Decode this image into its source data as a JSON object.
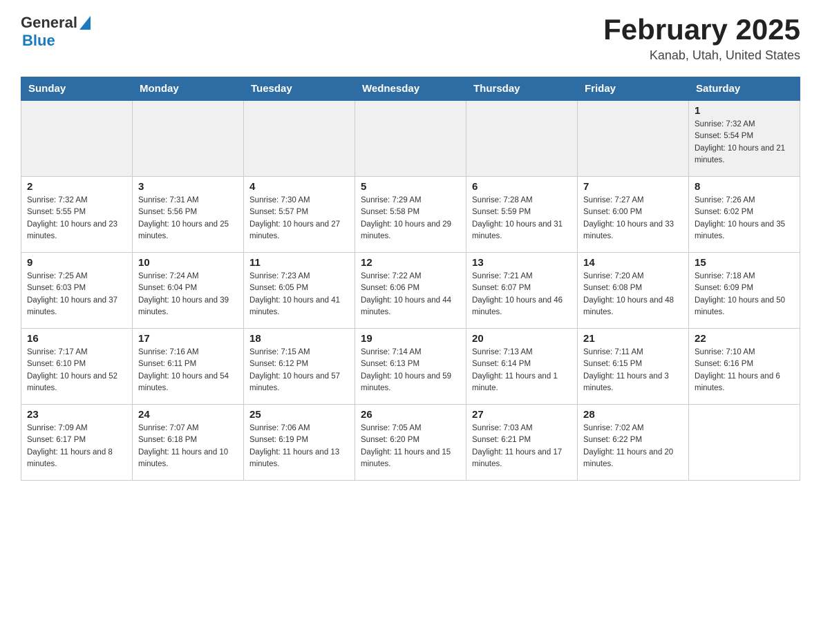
{
  "logo": {
    "general": "General",
    "blue": "Blue"
  },
  "title": "February 2025",
  "subtitle": "Kanab, Utah, United States",
  "headers": [
    "Sunday",
    "Monday",
    "Tuesday",
    "Wednesday",
    "Thursday",
    "Friday",
    "Saturday"
  ],
  "weeks": [
    [
      {
        "day": "",
        "sunrise": "",
        "sunset": "",
        "daylight": ""
      },
      {
        "day": "",
        "sunrise": "",
        "sunset": "",
        "daylight": ""
      },
      {
        "day": "",
        "sunrise": "",
        "sunset": "",
        "daylight": ""
      },
      {
        "day": "",
        "sunrise": "",
        "sunset": "",
        "daylight": ""
      },
      {
        "day": "",
        "sunrise": "",
        "sunset": "",
        "daylight": ""
      },
      {
        "day": "",
        "sunrise": "",
        "sunset": "",
        "daylight": ""
      },
      {
        "day": "1",
        "sunrise": "Sunrise: 7:32 AM",
        "sunset": "Sunset: 5:54 PM",
        "daylight": "Daylight: 10 hours and 21 minutes."
      }
    ],
    [
      {
        "day": "2",
        "sunrise": "Sunrise: 7:32 AM",
        "sunset": "Sunset: 5:55 PM",
        "daylight": "Daylight: 10 hours and 23 minutes."
      },
      {
        "day": "3",
        "sunrise": "Sunrise: 7:31 AM",
        "sunset": "Sunset: 5:56 PM",
        "daylight": "Daylight: 10 hours and 25 minutes."
      },
      {
        "day": "4",
        "sunrise": "Sunrise: 7:30 AM",
        "sunset": "Sunset: 5:57 PM",
        "daylight": "Daylight: 10 hours and 27 minutes."
      },
      {
        "day": "5",
        "sunrise": "Sunrise: 7:29 AM",
        "sunset": "Sunset: 5:58 PM",
        "daylight": "Daylight: 10 hours and 29 minutes."
      },
      {
        "day": "6",
        "sunrise": "Sunrise: 7:28 AM",
        "sunset": "Sunset: 5:59 PM",
        "daylight": "Daylight: 10 hours and 31 minutes."
      },
      {
        "day": "7",
        "sunrise": "Sunrise: 7:27 AM",
        "sunset": "Sunset: 6:00 PM",
        "daylight": "Daylight: 10 hours and 33 minutes."
      },
      {
        "day": "8",
        "sunrise": "Sunrise: 7:26 AM",
        "sunset": "Sunset: 6:02 PM",
        "daylight": "Daylight: 10 hours and 35 minutes."
      }
    ],
    [
      {
        "day": "9",
        "sunrise": "Sunrise: 7:25 AM",
        "sunset": "Sunset: 6:03 PM",
        "daylight": "Daylight: 10 hours and 37 minutes."
      },
      {
        "day": "10",
        "sunrise": "Sunrise: 7:24 AM",
        "sunset": "Sunset: 6:04 PM",
        "daylight": "Daylight: 10 hours and 39 minutes."
      },
      {
        "day": "11",
        "sunrise": "Sunrise: 7:23 AM",
        "sunset": "Sunset: 6:05 PM",
        "daylight": "Daylight: 10 hours and 41 minutes."
      },
      {
        "day": "12",
        "sunrise": "Sunrise: 7:22 AM",
        "sunset": "Sunset: 6:06 PM",
        "daylight": "Daylight: 10 hours and 44 minutes."
      },
      {
        "day": "13",
        "sunrise": "Sunrise: 7:21 AM",
        "sunset": "Sunset: 6:07 PM",
        "daylight": "Daylight: 10 hours and 46 minutes."
      },
      {
        "day": "14",
        "sunrise": "Sunrise: 7:20 AM",
        "sunset": "Sunset: 6:08 PM",
        "daylight": "Daylight: 10 hours and 48 minutes."
      },
      {
        "day": "15",
        "sunrise": "Sunrise: 7:18 AM",
        "sunset": "Sunset: 6:09 PM",
        "daylight": "Daylight: 10 hours and 50 minutes."
      }
    ],
    [
      {
        "day": "16",
        "sunrise": "Sunrise: 7:17 AM",
        "sunset": "Sunset: 6:10 PM",
        "daylight": "Daylight: 10 hours and 52 minutes."
      },
      {
        "day": "17",
        "sunrise": "Sunrise: 7:16 AM",
        "sunset": "Sunset: 6:11 PM",
        "daylight": "Daylight: 10 hours and 54 minutes."
      },
      {
        "day": "18",
        "sunrise": "Sunrise: 7:15 AM",
        "sunset": "Sunset: 6:12 PM",
        "daylight": "Daylight: 10 hours and 57 minutes."
      },
      {
        "day": "19",
        "sunrise": "Sunrise: 7:14 AM",
        "sunset": "Sunset: 6:13 PM",
        "daylight": "Daylight: 10 hours and 59 minutes."
      },
      {
        "day": "20",
        "sunrise": "Sunrise: 7:13 AM",
        "sunset": "Sunset: 6:14 PM",
        "daylight": "Daylight: 11 hours and 1 minute."
      },
      {
        "day": "21",
        "sunrise": "Sunrise: 7:11 AM",
        "sunset": "Sunset: 6:15 PM",
        "daylight": "Daylight: 11 hours and 3 minutes."
      },
      {
        "day": "22",
        "sunrise": "Sunrise: 7:10 AM",
        "sunset": "Sunset: 6:16 PM",
        "daylight": "Daylight: 11 hours and 6 minutes."
      }
    ],
    [
      {
        "day": "23",
        "sunrise": "Sunrise: 7:09 AM",
        "sunset": "Sunset: 6:17 PM",
        "daylight": "Daylight: 11 hours and 8 minutes."
      },
      {
        "day": "24",
        "sunrise": "Sunrise: 7:07 AM",
        "sunset": "Sunset: 6:18 PM",
        "daylight": "Daylight: 11 hours and 10 minutes."
      },
      {
        "day": "25",
        "sunrise": "Sunrise: 7:06 AM",
        "sunset": "Sunset: 6:19 PM",
        "daylight": "Daylight: 11 hours and 13 minutes."
      },
      {
        "day": "26",
        "sunrise": "Sunrise: 7:05 AM",
        "sunset": "Sunset: 6:20 PM",
        "daylight": "Daylight: 11 hours and 15 minutes."
      },
      {
        "day": "27",
        "sunrise": "Sunrise: 7:03 AM",
        "sunset": "Sunset: 6:21 PM",
        "daylight": "Daylight: 11 hours and 17 minutes."
      },
      {
        "day": "28",
        "sunrise": "Sunrise: 7:02 AM",
        "sunset": "Sunset: 6:22 PM",
        "daylight": "Daylight: 11 hours and 20 minutes."
      },
      {
        "day": "",
        "sunrise": "",
        "sunset": "",
        "daylight": ""
      }
    ]
  ]
}
